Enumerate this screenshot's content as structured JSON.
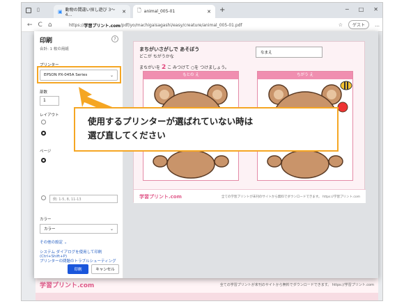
{
  "browser": {
    "tabs": [
      {
        "label": "動物の間違い探し遊び 3～4…"
      },
      {
        "label": "animal_005-01"
      }
    ],
    "new_tab": "+",
    "window_controls": [
      "─",
      "□",
      "✕"
    ],
    "nav": {
      "back": "←",
      "refresh": "C",
      "home": "⌂"
    },
    "url_prefix": "https://",
    "url_domain": "学習プリント.com",
    "url_path": "/pdf/yo/machigaisagashi/easy/creature/animal_005-01.pdf",
    "profile": "ゲスト",
    "more": "…"
  },
  "background": {
    "footer_logo": "学習プリント.com",
    "footer_note": "全ての学習プリントが未刊のサイトから無料でダウンロードできます。 https://学習プリント.com"
  },
  "print_dialog": {
    "title": "印刷",
    "subtitle": "合計: 1 枚の用紙",
    "help": "?",
    "printer_label": "プリンター",
    "printer_value": "EPSON PX-045A Series",
    "copies_label": "部数",
    "copies_value": "1",
    "layout_label": "レイアウト",
    "pages_label": "ページ",
    "pages_placeholder": "例: 1-5, 8, 11-13",
    "color_label": "カラー",
    "color_value": "カラー",
    "more_settings": "その他の設定 ⌄",
    "system_dialog": "システム ダイアログを使用して印刷 (Ctrl+Shift+P)",
    "troubleshoot": "プリンターの問題のトラブルシューティング",
    "print_button": "印刷",
    "cancel_button": "キャンセル"
  },
  "preview": {
    "title": "まちがいさがしで あそぼう",
    "subtitle": "どこが ちがうかな",
    "name_label": "なまえ",
    "instruction_pre": "まちがいを",
    "instruction_num": "2",
    "instruction_post": "こ みつけて ○を つけましょう。",
    "caption_left": "もとの え",
    "caption_right": "ちがう え",
    "footer_logo": "学習プリント.com",
    "footer_note": "全ての学習プリントが未刊のサイトから無料でダウンロードできます。 https://学習プリント.com"
  },
  "callout": {
    "line1": "使用するプリンターが選ばれていない時は",
    "line2": "選び直してください"
  },
  "colors": {
    "accent_orange": "#f5a623",
    "print_blue": "#1a56db",
    "pink": "#f08eb0"
  }
}
